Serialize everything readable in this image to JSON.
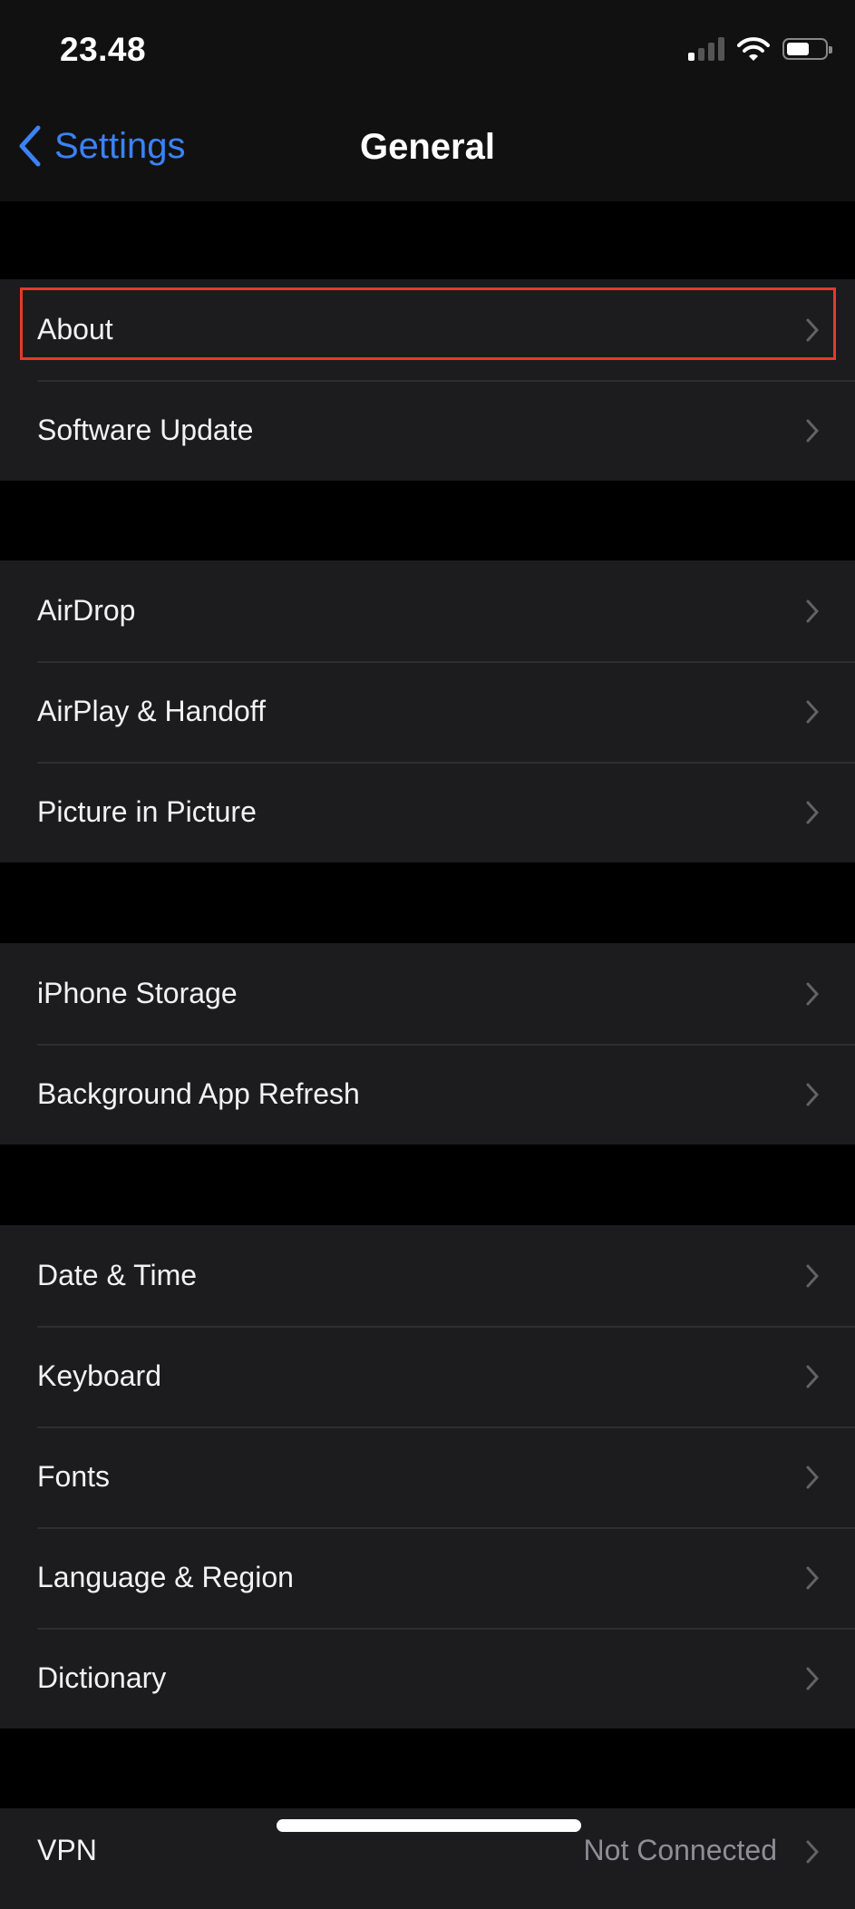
{
  "status_bar": {
    "time": "23.48",
    "signal_bars_on": 1,
    "signal_bars_total": 4,
    "battery_level": 0.55
  },
  "nav": {
    "back_label": "Settings",
    "title": "General"
  },
  "groups": [
    {
      "items": [
        {
          "label": "About",
          "highlighted": true
        },
        {
          "label": "Software Update"
        }
      ]
    },
    {
      "items": [
        {
          "label": "AirDrop"
        },
        {
          "label": "AirPlay & Handoff"
        },
        {
          "label": "Picture in Picture"
        }
      ]
    },
    {
      "items": [
        {
          "label": "iPhone Storage"
        },
        {
          "label": "Background App Refresh"
        }
      ]
    },
    {
      "items": [
        {
          "label": "Date & Time"
        },
        {
          "label": "Keyboard"
        },
        {
          "label": "Fonts"
        },
        {
          "label": "Language & Region"
        },
        {
          "label": "Dictionary"
        }
      ]
    },
    {
      "items": [
        {
          "label": "VPN",
          "value": "Not Connected"
        }
      ]
    }
  ],
  "colors": {
    "accent": "#3b82f6",
    "highlight_border": "#e53a2a",
    "row_bg": "#1c1c1e"
  }
}
